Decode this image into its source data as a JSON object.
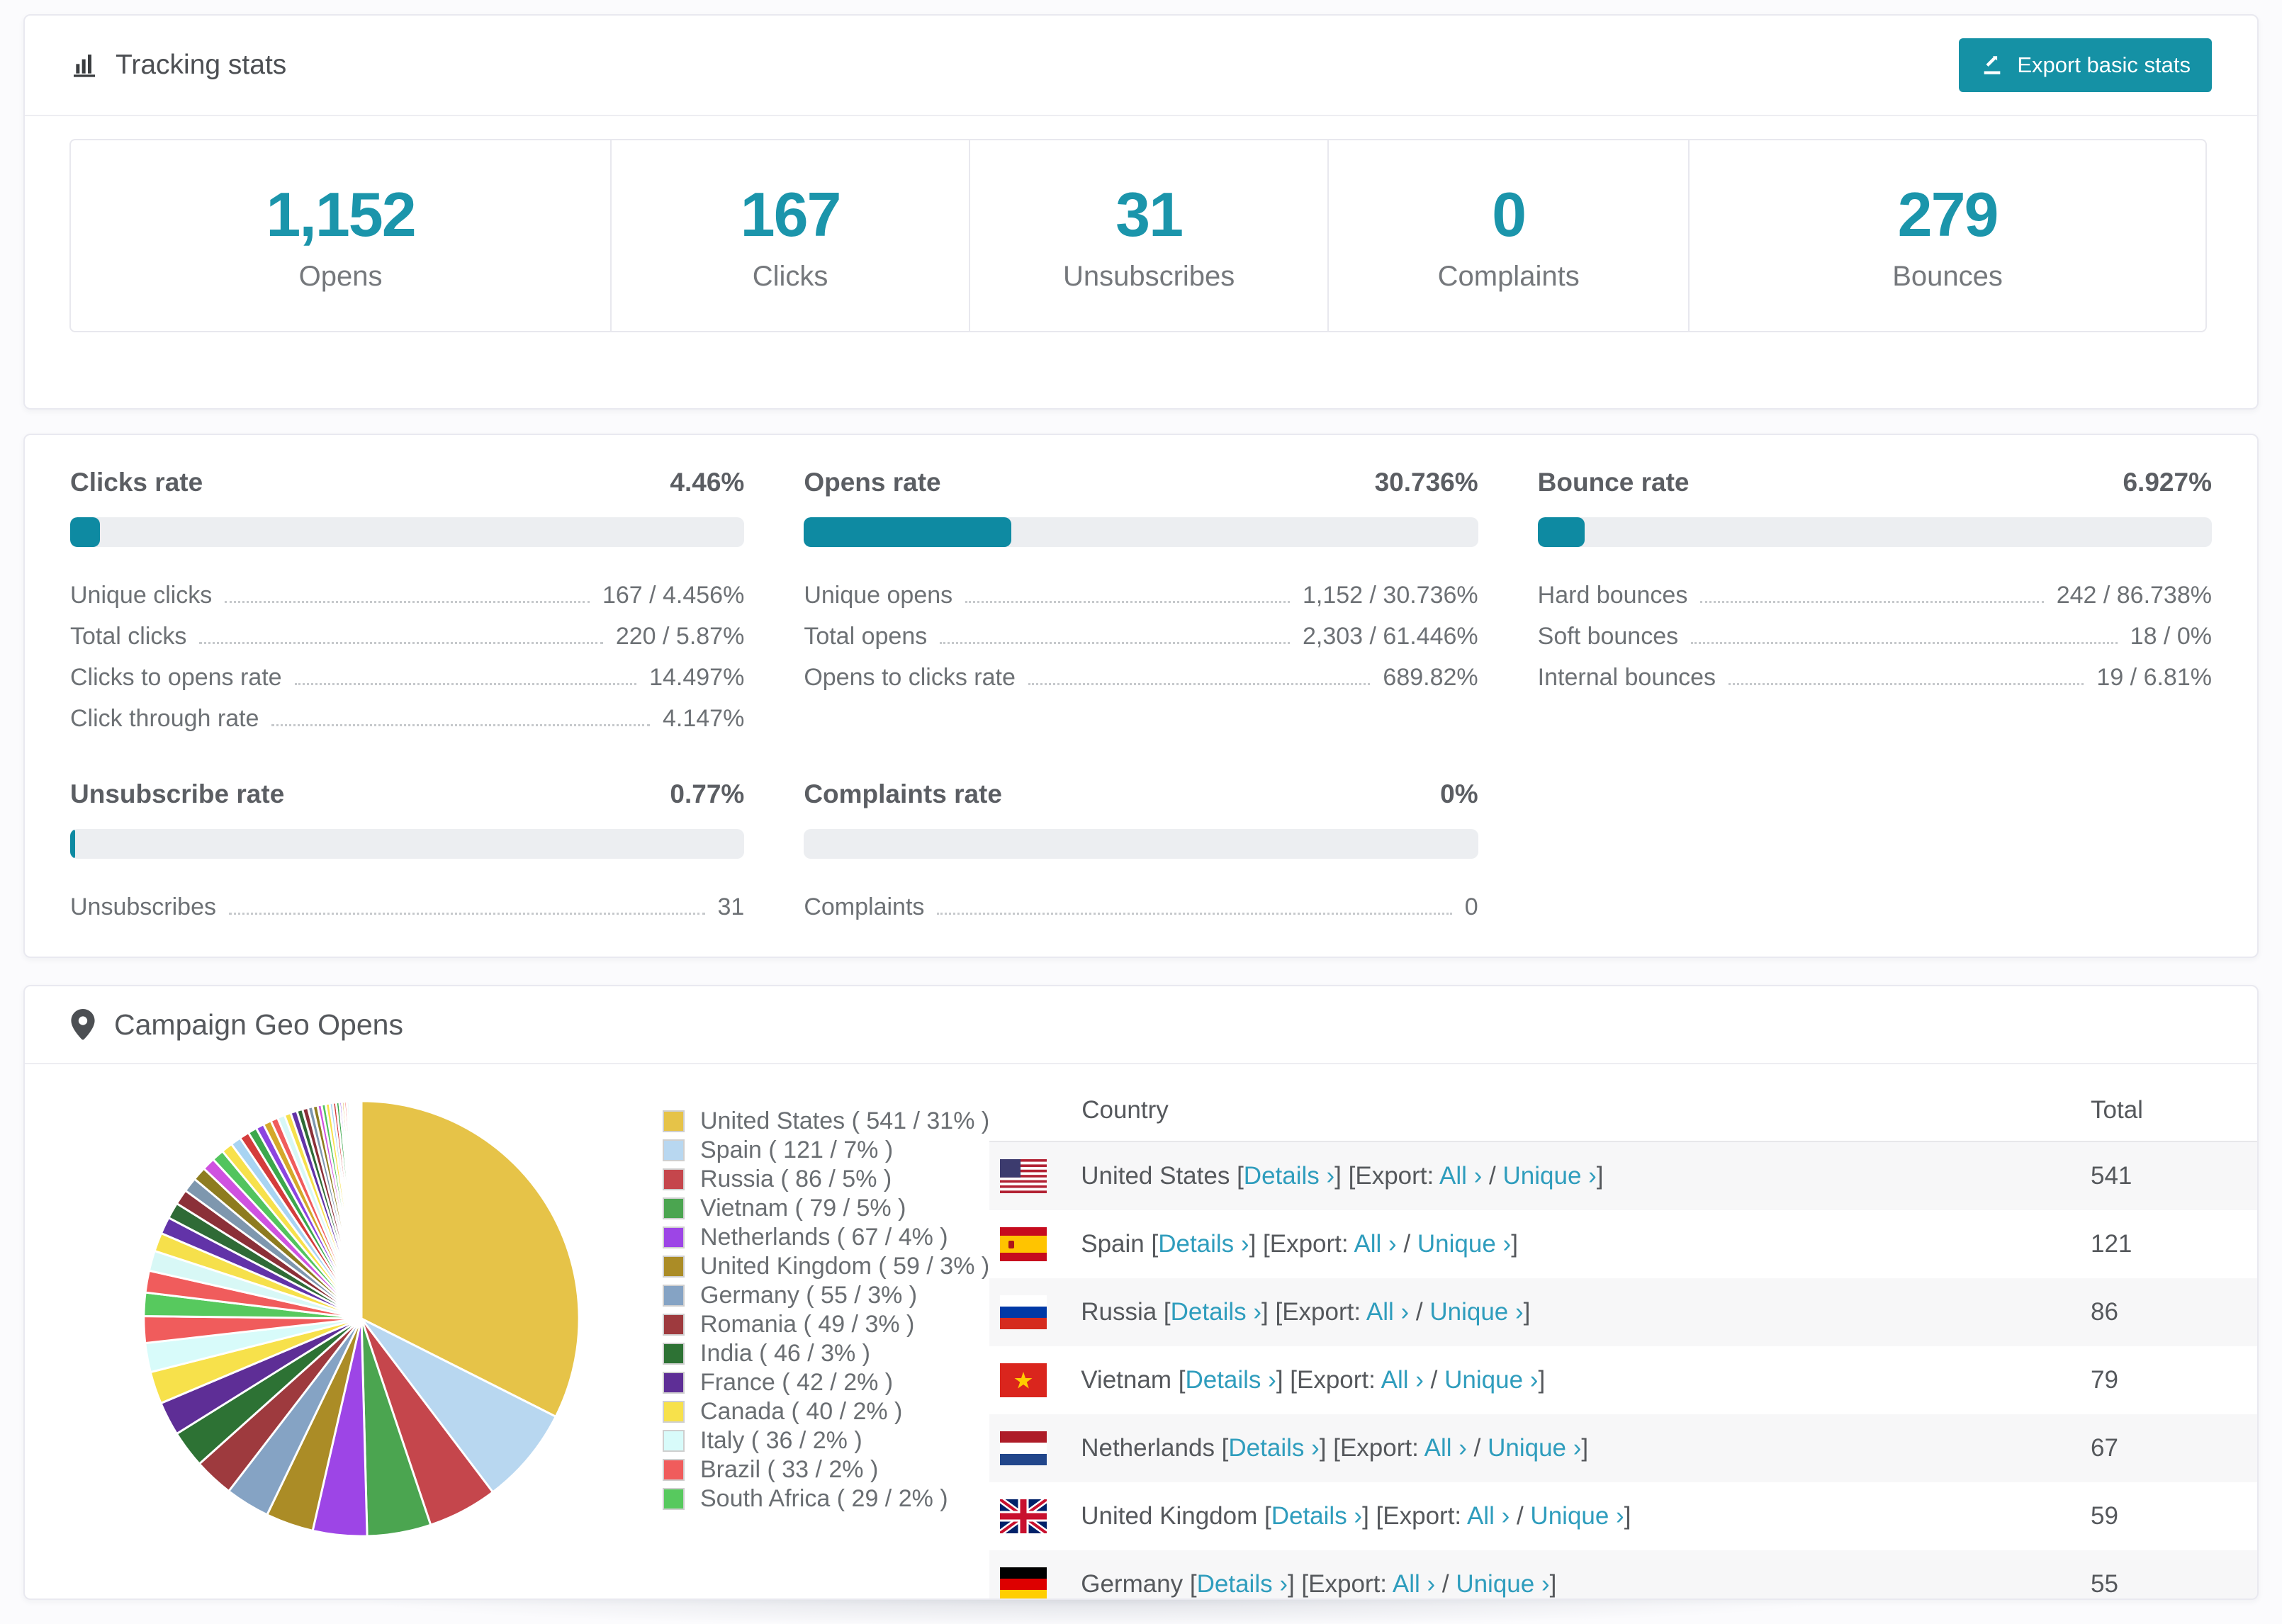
{
  "colors": {
    "accent": "#1591a5",
    "stat_number": "#1b95ab",
    "bar_fill": "#0e8aa2",
    "bar_track": "#eceef1",
    "link": "#2f9dbd"
  },
  "header": {
    "title": "Tracking stats",
    "icon": "bar-chart-icon",
    "export_button": {
      "label": "Export basic stats",
      "icon": "export-icon"
    }
  },
  "summary_stats": [
    {
      "value": "1,152",
      "label": "Opens"
    },
    {
      "value": "167",
      "label": "Clicks"
    },
    {
      "value": "31",
      "label": "Unsubscribes"
    },
    {
      "value": "0",
      "label": "Complaints"
    },
    {
      "value": "279",
      "label": "Bounces"
    }
  ],
  "rates": [
    {
      "title": "Clicks rate",
      "value_label": "4.46%",
      "percent": 4.46,
      "rows": [
        {
          "label": "Unique clicks",
          "value": "167 / 4.456%"
        },
        {
          "label": "Total clicks",
          "value": "220 / 5.87%"
        },
        {
          "label": "Clicks to opens rate",
          "value": "14.497%"
        },
        {
          "label": "Click through rate",
          "value": "4.147%"
        }
      ]
    },
    {
      "title": "Opens rate",
      "value_label": "30.736%",
      "percent": 30.736,
      "rows": [
        {
          "label": "Unique opens",
          "value": "1,152 / 30.736%"
        },
        {
          "label": "Total opens",
          "value": "2,303 / 61.446%"
        },
        {
          "label": "Opens to clicks rate",
          "value": "689.82%"
        }
      ]
    },
    {
      "title": "Bounce rate",
      "value_label": "6.927%",
      "percent": 6.927,
      "rows": [
        {
          "label": "Hard bounces",
          "value": "242 / 86.738%"
        },
        {
          "label": "Soft bounces",
          "value": "18 / 0%"
        },
        {
          "label": "Internal bounces",
          "value": "19 / 6.81%"
        }
      ]
    },
    {
      "title": "Unsubscribe rate",
      "value_label": "0.77%",
      "percent": 0.77,
      "rows": [
        {
          "label": "Unsubscribes",
          "value": "31"
        }
      ]
    },
    {
      "title": "Complaints rate",
      "value_label": "0%",
      "percent": 0,
      "rows": [
        {
          "label": "Complaints",
          "value": "0"
        }
      ]
    }
  ],
  "geo": {
    "title": "Campaign Geo Opens",
    "icon": "map-marker-icon",
    "table": {
      "columns": [
        "Country",
        "Total"
      ],
      "links": {
        "details": "Details ›",
        "export_prefix": "[Export: ",
        "all": "All ›",
        "separator": " / ",
        "unique": "Unique ›",
        "close": "]"
      },
      "rows": [
        {
          "country": "United States",
          "flag": "us",
          "total": "541"
        },
        {
          "country": "Spain",
          "flag": "es",
          "total": "121"
        },
        {
          "country": "Russia",
          "flag": "ru",
          "total": "86"
        },
        {
          "country": "Vietnam",
          "flag": "vn",
          "total": "79"
        },
        {
          "country": "Netherlands",
          "flag": "nl",
          "total": "67"
        },
        {
          "country": "United Kingdom",
          "flag": "gb",
          "total": "59"
        },
        {
          "country": "Germany",
          "flag": "de",
          "total": "55"
        }
      ]
    }
  },
  "chart_data": {
    "type": "pie",
    "title": "Campaign Geo Opens",
    "legend_position": "right-of-pie",
    "start_angle_deg": -90,
    "direction": "clockwise",
    "slices": [
      {
        "label": "United States",
        "value": 541,
        "pct": "31%",
        "color": "#e6c348"
      },
      {
        "label": "Spain",
        "value": 121,
        "pct": "7%",
        "color": "#b8d7f0"
      },
      {
        "label": "Russia",
        "value": 86,
        "pct": "5%",
        "color": "#c5464c"
      },
      {
        "label": "Vietnam",
        "value": 79,
        "pct": "5%",
        "color": "#4ba550"
      },
      {
        "label": "Netherlands",
        "value": 67,
        "pct": "4%",
        "color": "#9d45e6"
      },
      {
        "label": "United Kingdom",
        "value": 59,
        "pct": "3%",
        "color": "#ab8c26"
      },
      {
        "label": "Germany",
        "value": 55,
        "pct": "3%",
        "color": "#85a3c4"
      },
      {
        "label": "Romania",
        "value": 49,
        "pct": "3%",
        "color": "#9e3a3e"
      },
      {
        "label": "India",
        "value": 46,
        "pct": "3%",
        "color": "#2d7234"
      },
      {
        "label": "France",
        "value": 42,
        "pct": "2%",
        "color": "#5e2e96"
      },
      {
        "label": "Canada",
        "value": 40,
        "pct": "2%",
        "color": "#f7e14b"
      },
      {
        "label": "Italy",
        "value": 36,
        "pct": "2%",
        "color": "#d8fbfa"
      },
      {
        "label": "Brazil",
        "value": 33,
        "pct": "2%",
        "color": "#f05c5c"
      },
      {
        "label": "South Africa",
        "value": 29,
        "pct": "2%",
        "color": "#57c95e"
      }
    ],
    "other_slices_values": [
      27,
      25,
      23,
      21,
      20,
      19,
      18,
      17,
      16,
      15,
      14,
      13,
      12,
      11,
      10,
      10,
      9,
      9,
      8,
      8,
      7,
      7,
      6,
      6,
      5,
      5,
      5,
      4,
      4,
      4,
      3,
      3,
      3,
      3,
      2,
      2,
      2,
      2,
      2,
      1,
      1,
      1,
      1,
      1
    ],
    "other_slices_palette": [
      "#f05c5c",
      "#d8f8f6",
      "#f6e04b",
      "#6233a8",
      "#2f6b36",
      "#8b3038",
      "#7e97ae",
      "#8e7c20",
      "#cf52e0",
      "#52c45e",
      "#f7e14b",
      "#a8d4f2",
      "#d43c3c",
      "#3ca84c",
      "#8c44e0",
      "#d4a82a"
    ]
  }
}
